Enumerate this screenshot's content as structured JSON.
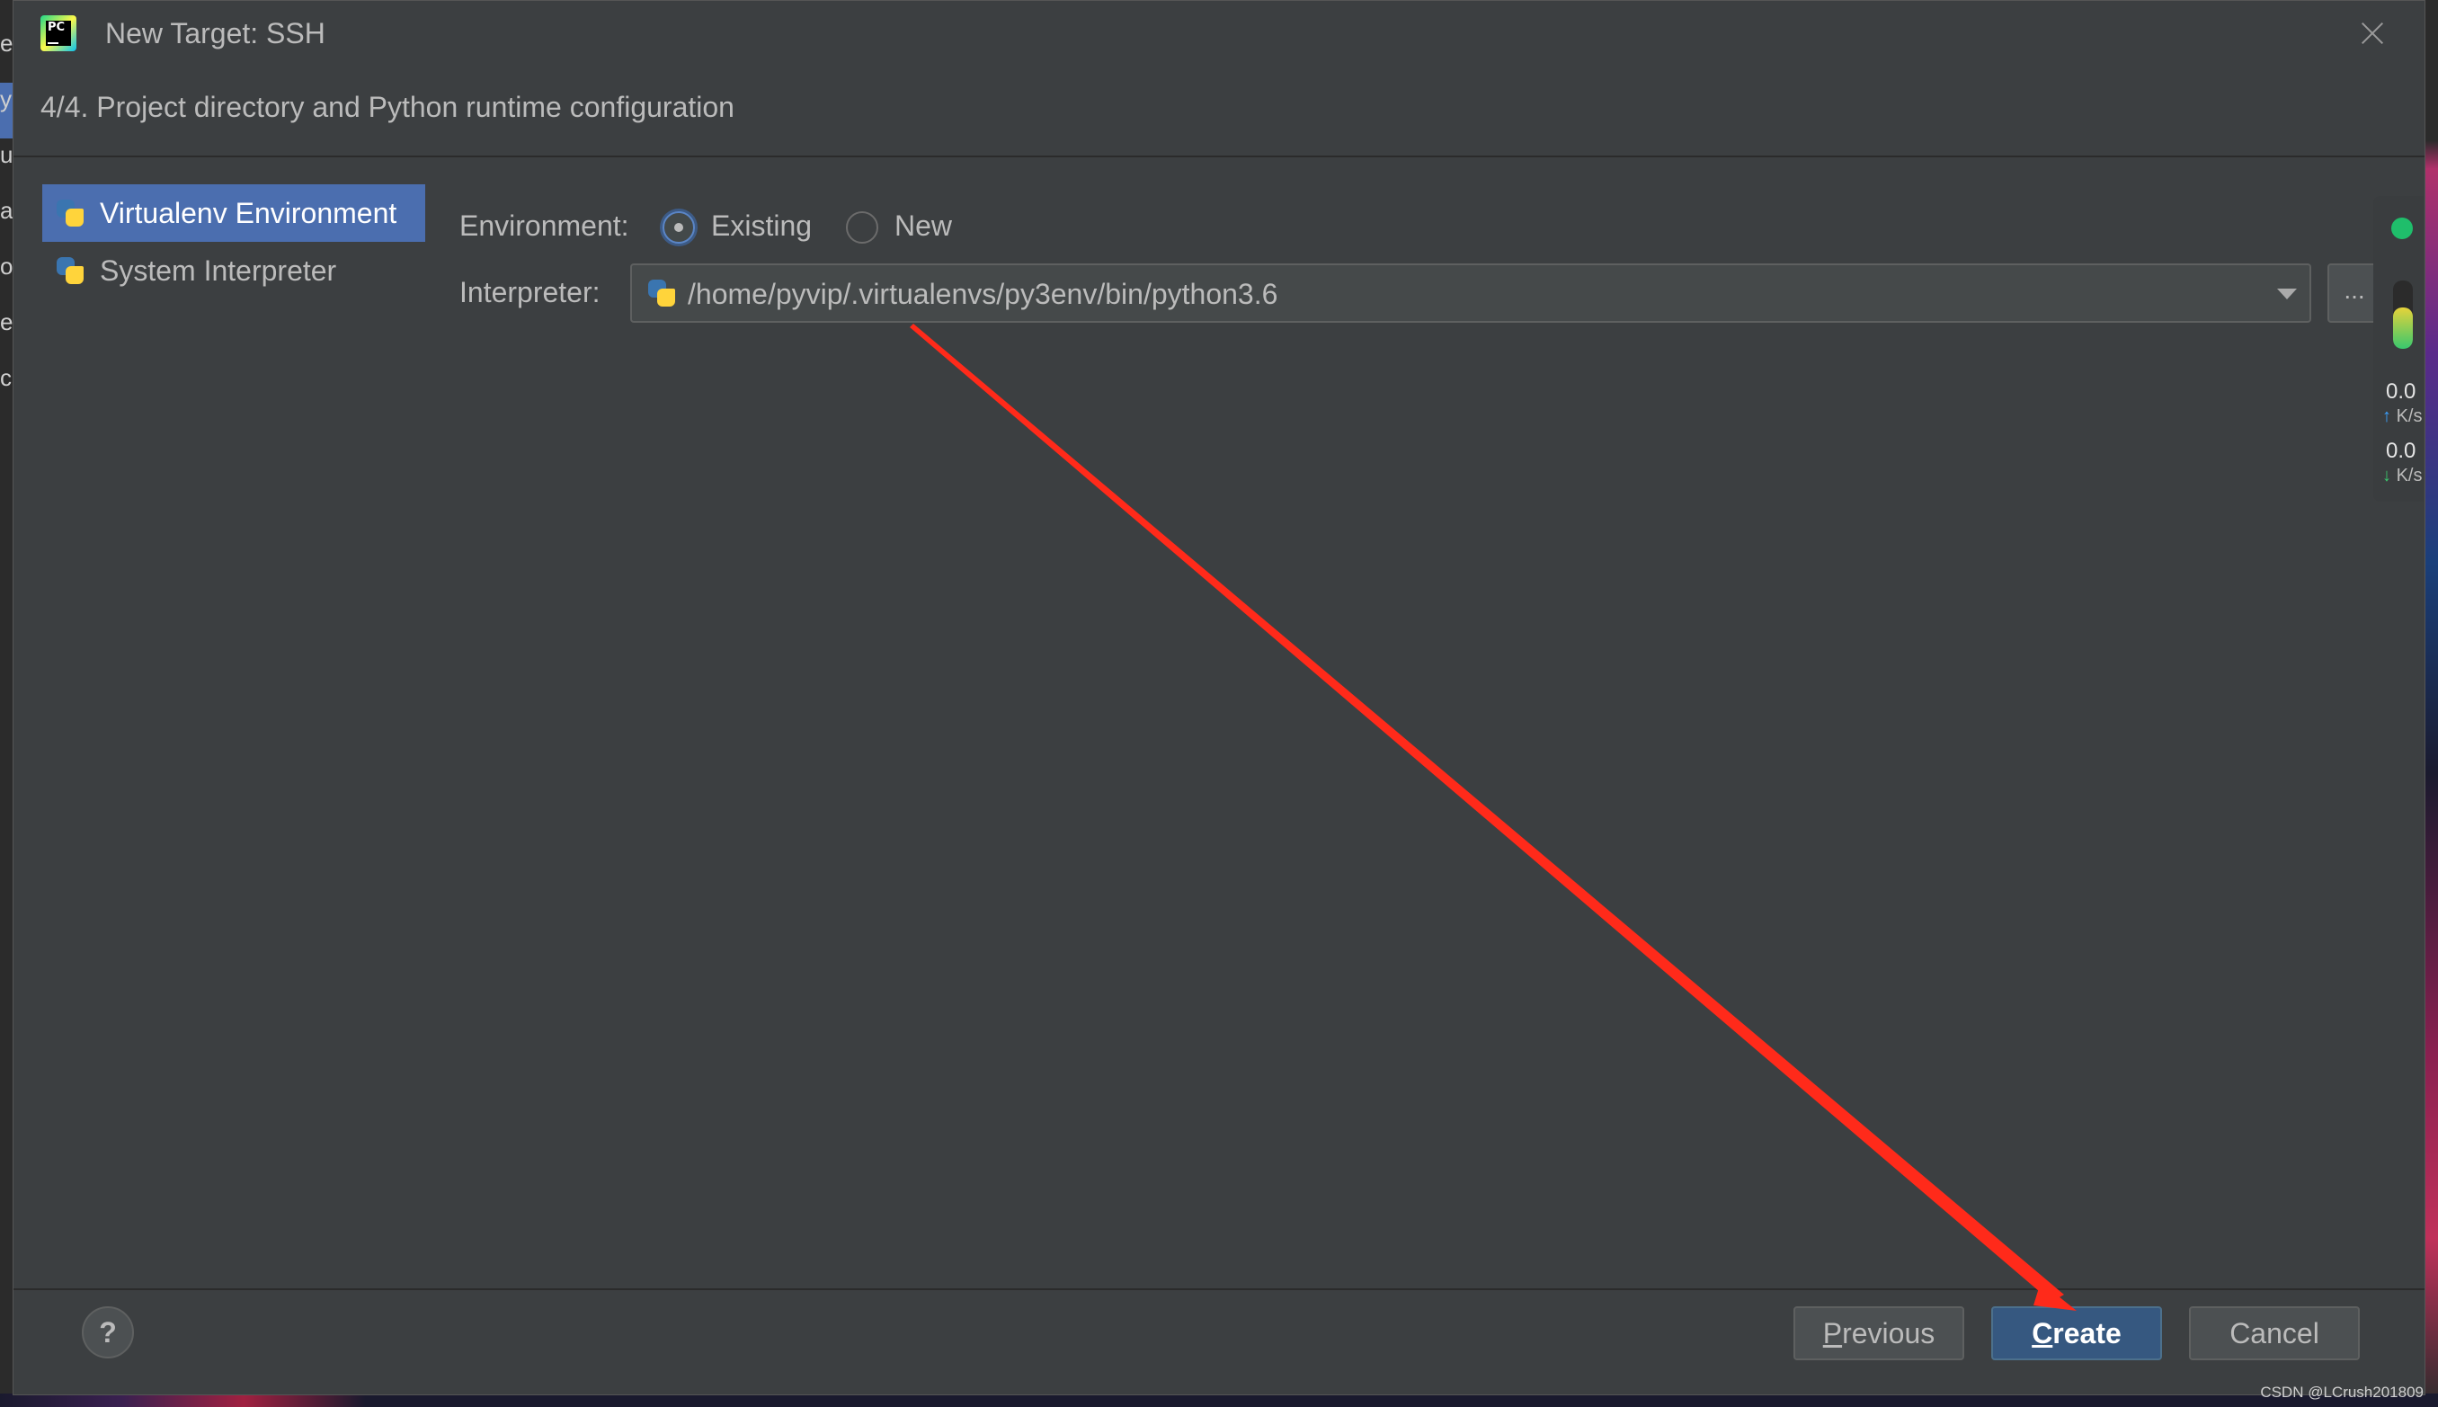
{
  "dialog": {
    "title": "New Target: SSH",
    "step_header": "4/4. Project directory and Python runtime configuration"
  },
  "environments": [
    {
      "label": "Virtualenv Environment",
      "selected": true
    },
    {
      "label": "System Interpreter",
      "selected": false
    }
  ],
  "form": {
    "environment_label": "Environment:",
    "existing_label": "Existing",
    "new_label": "New",
    "selected_option": "Existing",
    "interpreter_label": "Interpreter:",
    "interpreter_value": "/home/pyvip/.virtualenvs/py3env/bin/python3.6",
    "browse_label": "..."
  },
  "footer": {
    "help_label": "?",
    "previous_first": "P",
    "previous_rest": "revious",
    "create_first": "C",
    "create_rest": "reate",
    "cancel_label": "Cancel"
  },
  "widget": {
    "upload_value": "0.0",
    "upload_unit": "K/s",
    "download_value": "0.0",
    "download_unit": "K/s",
    "status_color": "#1fbe6b"
  },
  "background_letters": [
    "e",
    "y",
    "u",
    "a",
    "o",
    "e",
    "c"
  ],
  "watermark": "CSDN @LCrush201809",
  "colors": {
    "dialog_bg": "#3c3f41",
    "selection": "#4b6eaf",
    "primary_button": "#365880",
    "annotation_arrow": "#ff2a1a"
  }
}
